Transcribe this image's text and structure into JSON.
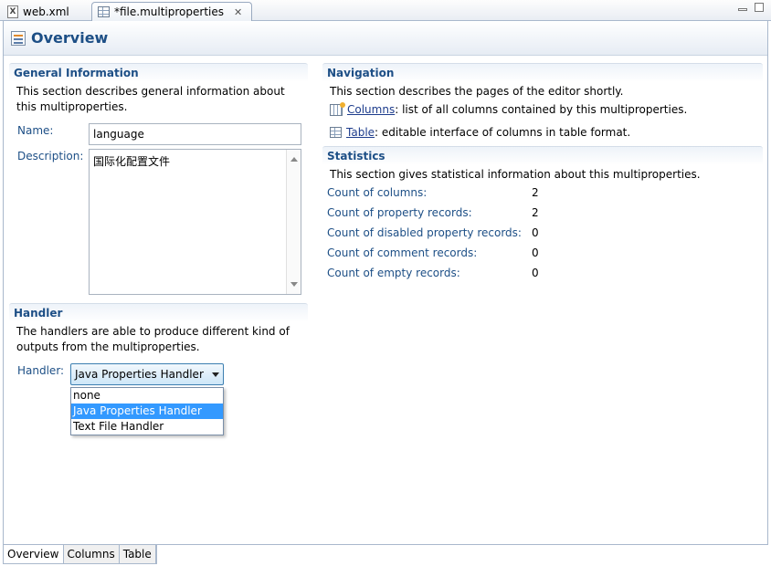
{
  "tabs": [
    {
      "label": "web.xml",
      "icon": "xml-file-icon"
    },
    {
      "label": "*file.multiproperties",
      "icon": "table-file-icon"
    }
  ],
  "header": {
    "title": "Overview"
  },
  "general": {
    "title": "General Information",
    "description": "This section describes general information about this multiproperties.",
    "name_label": "Name:",
    "name_value": "language",
    "description_label": "Description:",
    "description_value": "国际化配置文件"
  },
  "handler": {
    "title": "Handler",
    "description": "The handlers are able to produce different kind of outputs from the multiproperties.",
    "label": "Handler:",
    "selected": "Java Properties Handler",
    "options": [
      "none",
      "Java Properties Handler",
      "Text File Handler"
    ]
  },
  "navigation": {
    "title": "Navigation",
    "description": "This section describes the pages of the editor shortly.",
    "items": [
      {
        "link": "Columns",
        "text": ": list of all columns contained by this multiproperties."
      },
      {
        "link": "Table",
        "text": ": editable interface of columns in table format."
      }
    ]
  },
  "statistics": {
    "title": "Statistics",
    "description": "This section gives statistical information about this multiproperties.",
    "rows": [
      {
        "label": "Count of columns:",
        "value": "2"
      },
      {
        "label": "Count of property records:",
        "value": "2"
      },
      {
        "label": "Count of disabled property records:",
        "value": "0"
      },
      {
        "label": "Count of comment records:",
        "value": "0"
      },
      {
        "label": "Count of empty records:",
        "value": "0"
      }
    ]
  },
  "bottom_tabs": [
    "Overview",
    "Columns",
    "Table"
  ]
}
